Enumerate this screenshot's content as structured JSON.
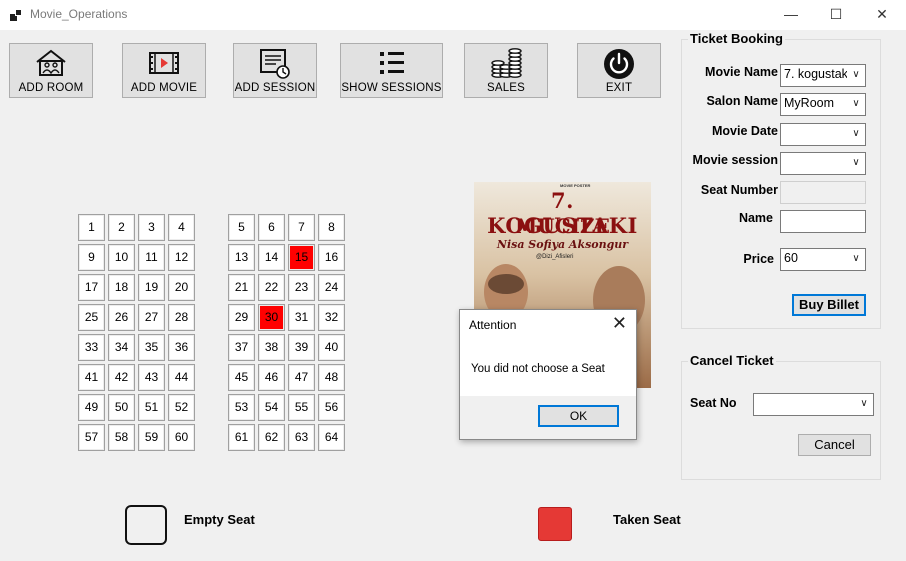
{
  "window": {
    "title": "Movie_Operations",
    "controls": {
      "minimize": "—",
      "maximize": "☐",
      "close": "✕"
    }
  },
  "toolbar": {
    "add_room": "ADD ROOM",
    "add_movie": "ADD MOVIE",
    "add_session": "ADD SESSION",
    "show_sessions": "SHOW SESSIONS",
    "sales": "SALES",
    "exit": "EXIT"
  },
  "seats": {
    "numbers": [
      1,
      2,
      3,
      4,
      5,
      6,
      7,
      8,
      9,
      10,
      11,
      12,
      13,
      14,
      15,
      16,
      17,
      18,
      19,
      20,
      21,
      22,
      23,
      24,
      25,
      26,
      27,
      28,
      29,
      30,
      31,
      32,
      33,
      34,
      35,
      36,
      37,
      38,
      39,
      40,
      41,
      42,
      43,
      44,
      45,
      46,
      47,
      48,
      49,
      50,
      51,
      52,
      53,
      54,
      55,
      56,
      57,
      58,
      59,
      60,
      61,
      62,
      63,
      64
    ],
    "taken": [
      15,
      30
    ]
  },
  "poster": {
    "top_text": "MOVIE POSTER",
    "title_line1": "7. KOGUSTAKI",
    "title_line2": "MUCIZE",
    "subtitle": "Nisa Sofiya Aksongur",
    "handle": "@Dizi_Afisleri"
  },
  "booking": {
    "legend": "Ticket Booking",
    "movie_name_label": "Movie Name",
    "movie_name_value": "7. kogustak",
    "salon_name_label": "Salon Name",
    "salon_name_value": "MyRoom",
    "movie_date_label": "Movie Date",
    "movie_date_value": "",
    "movie_session_label": "Movie session",
    "movie_session_value": "",
    "seat_number_label": "Seat Number",
    "seat_number_value": "",
    "name_label": "Name",
    "name_value": "",
    "price_label": "Price",
    "price_value": "60",
    "buy_button": "Buy Billet"
  },
  "cancel": {
    "legend": "Cancel Ticket",
    "seat_no_label": "Seat No",
    "seat_no_value": "",
    "cancel_button": "Cancel"
  },
  "seat_legend": {
    "empty": "Empty Seat",
    "taken": "Taken Seat",
    "taken_color": "#e53935"
  },
  "dialog": {
    "title": "Attention",
    "message": "You did not choose a Seat",
    "ok": "OK"
  }
}
